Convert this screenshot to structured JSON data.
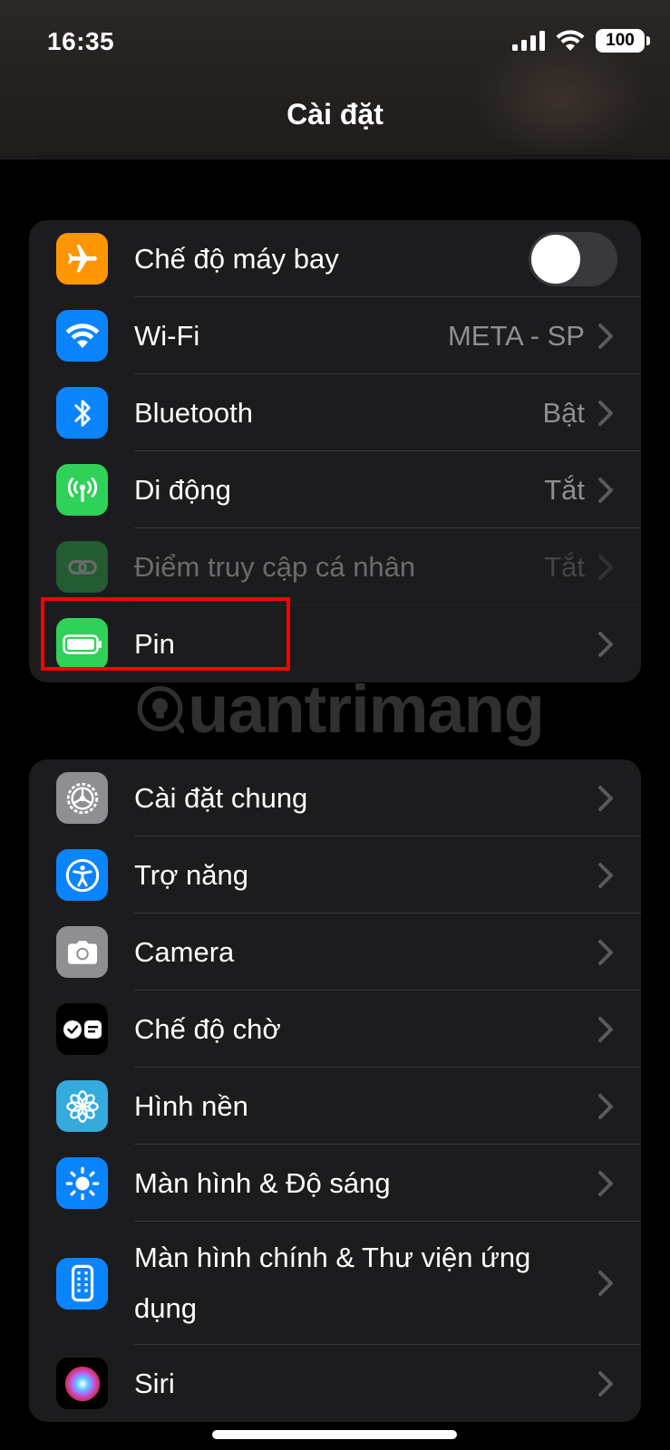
{
  "status_bar": {
    "time": "16:35",
    "battery": "100",
    "icons": [
      "cellular-signal-icon",
      "wifi-icon",
      "battery-icon"
    ]
  },
  "nav": {
    "title": "Cài đặt"
  },
  "group1": {
    "airplane": {
      "label": "Chế độ máy bay",
      "icon": "airplane-icon",
      "color": "#ff9500",
      "toggle_on": false
    },
    "wifi": {
      "label": "Wi-Fi",
      "value": "META - SP",
      "icon": "wifi-icon",
      "color": "#0a84ff"
    },
    "bluetooth": {
      "label": "Bluetooth",
      "value": "Bật",
      "icon": "bluetooth-icon",
      "color": "#0a84ff"
    },
    "cellular": {
      "label": "Di động",
      "value": "Tắt",
      "icon": "cellular-antenna-icon",
      "color": "#30d158"
    },
    "hotspot": {
      "label": "Điểm truy cập cá nhân",
      "value": "Tắt",
      "icon": "link-icon",
      "color": "#30d158",
      "disabled": true
    },
    "battery": {
      "label": "Pin",
      "icon": "battery-icon",
      "color": "#30d158",
      "highlighted": true
    }
  },
  "group2": {
    "general": {
      "label": "Cài đặt chung",
      "icon": "gear-icon",
      "color": "#8e8e93"
    },
    "accessibility": {
      "label": "Trợ năng",
      "icon": "accessibility-icon",
      "color": "#0a84ff"
    },
    "camera": {
      "label": "Camera",
      "icon": "camera-icon",
      "color": "#8e8e93"
    },
    "standby": {
      "label": "Chế độ chờ",
      "icon": "standby-icon",
      "color": "#000000"
    },
    "wallpaper": {
      "label": "Hình nền",
      "icon": "flower-icon",
      "color": "#35aadc"
    },
    "display": {
      "label": "Màn hình & Độ sáng",
      "icon": "sun-icon",
      "color": "#0a84ff"
    },
    "home_screen": {
      "label": "Màn hình chính & Thư viện ứng dụng",
      "icon": "home-screen-icon",
      "color": "#0a84ff"
    },
    "siri": {
      "label": "Siri",
      "icon": "siri-icon",
      "color": "#000000"
    }
  },
  "watermark": {
    "text": "uantrimang"
  }
}
